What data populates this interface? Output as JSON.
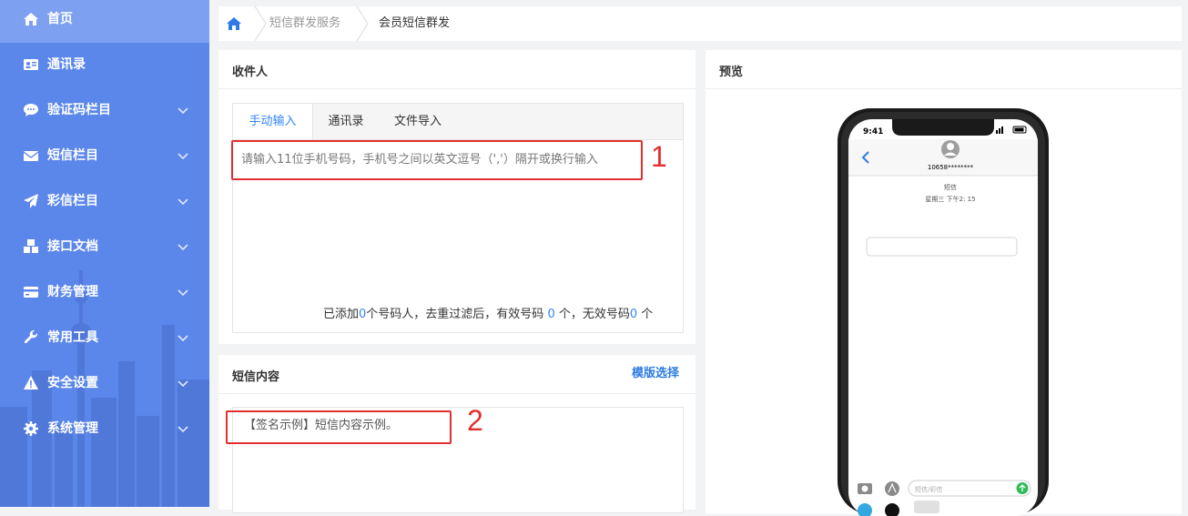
{
  "sidebar": {
    "items": [
      {
        "label": "首页",
        "icon": "home-icon",
        "active": true,
        "expandable": false
      },
      {
        "label": "通讯录",
        "icon": "address-card-icon",
        "active": false,
        "expandable": false
      },
      {
        "label": "验证码栏目",
        "icon": "comment-icon",
        "active": false,
        "expandable": true
      },
      {
        "label": "短信栏目",
        "icon": "envelope-icon",
        "active": false,
        "expandable": true
      },
      {
        "label": "彩信栏目",
        "icon": "paper-plane-icon",
        "active": false,
        "expandable": true
      },
      {
        "label": "接口文档",
        "icon": "cubes-icon",
        "active": false,
        "expandable": true
      },
      {
        "label": "财务管理",
        "icon": "credit-card-icon",
        "active": false,
        "expandable": true
      },
      {
        "label": "常用工具",
        "icon": "wrench-icon",
        "active": false,
        "expandable": true
      },
      {
        "label": "安全设置",
        "icon": "warning-icon",
        "active": false,
        "expandable": true
      },
      {
        "label": "系统管理",
        "icon": "gear-icon",
        "active": false,
        "expandable": true
      }
    ]
  },
  "breadcrumb": {
    "items": [
      "短信群发服务",
      "会员短信群发"
    ]
  },
  "recipients": {
    "title": "收件人",
    "tabs": [
      "手动输入",
      "通讯录",
      "文件导入"
    ],
    "placeholder": "请输入11位手机号码，手机号之间以英文逗号（','）隔开或换行输入",
    "annotation": "1",
    "counts": {
      "prefix": "已添加",
      "added": "0",
      "mid1": "个号码人，去重过滤后，有效号码 ",
      "valid": "0",
      "mid2": " 个，无效号码",
      "invalid": "0",
      "suffix": " 个"
    }
  },
  "sms": {
    "title": "短信内容",
    "template_link": "模版选择",
    "content": "【签名示例】短信内容示例。",
    "annotation": "2"
  },
  "preview": {
    "title": "预览",
    "phone": {
      "time": "9:41",
      "number": "10658********",
      "label": "短信",
      "timestamp": "星期三 下午2: 15",
      "input_placeholder": "短信/彩信"
    }
  },
  "colors": {
    "sidebar": "#5b86ea",
    "sidebar_active": "#7da0f0",
    "accent": "#3385ff",
    "annotation_red": "#e32e2e"
  }
}
